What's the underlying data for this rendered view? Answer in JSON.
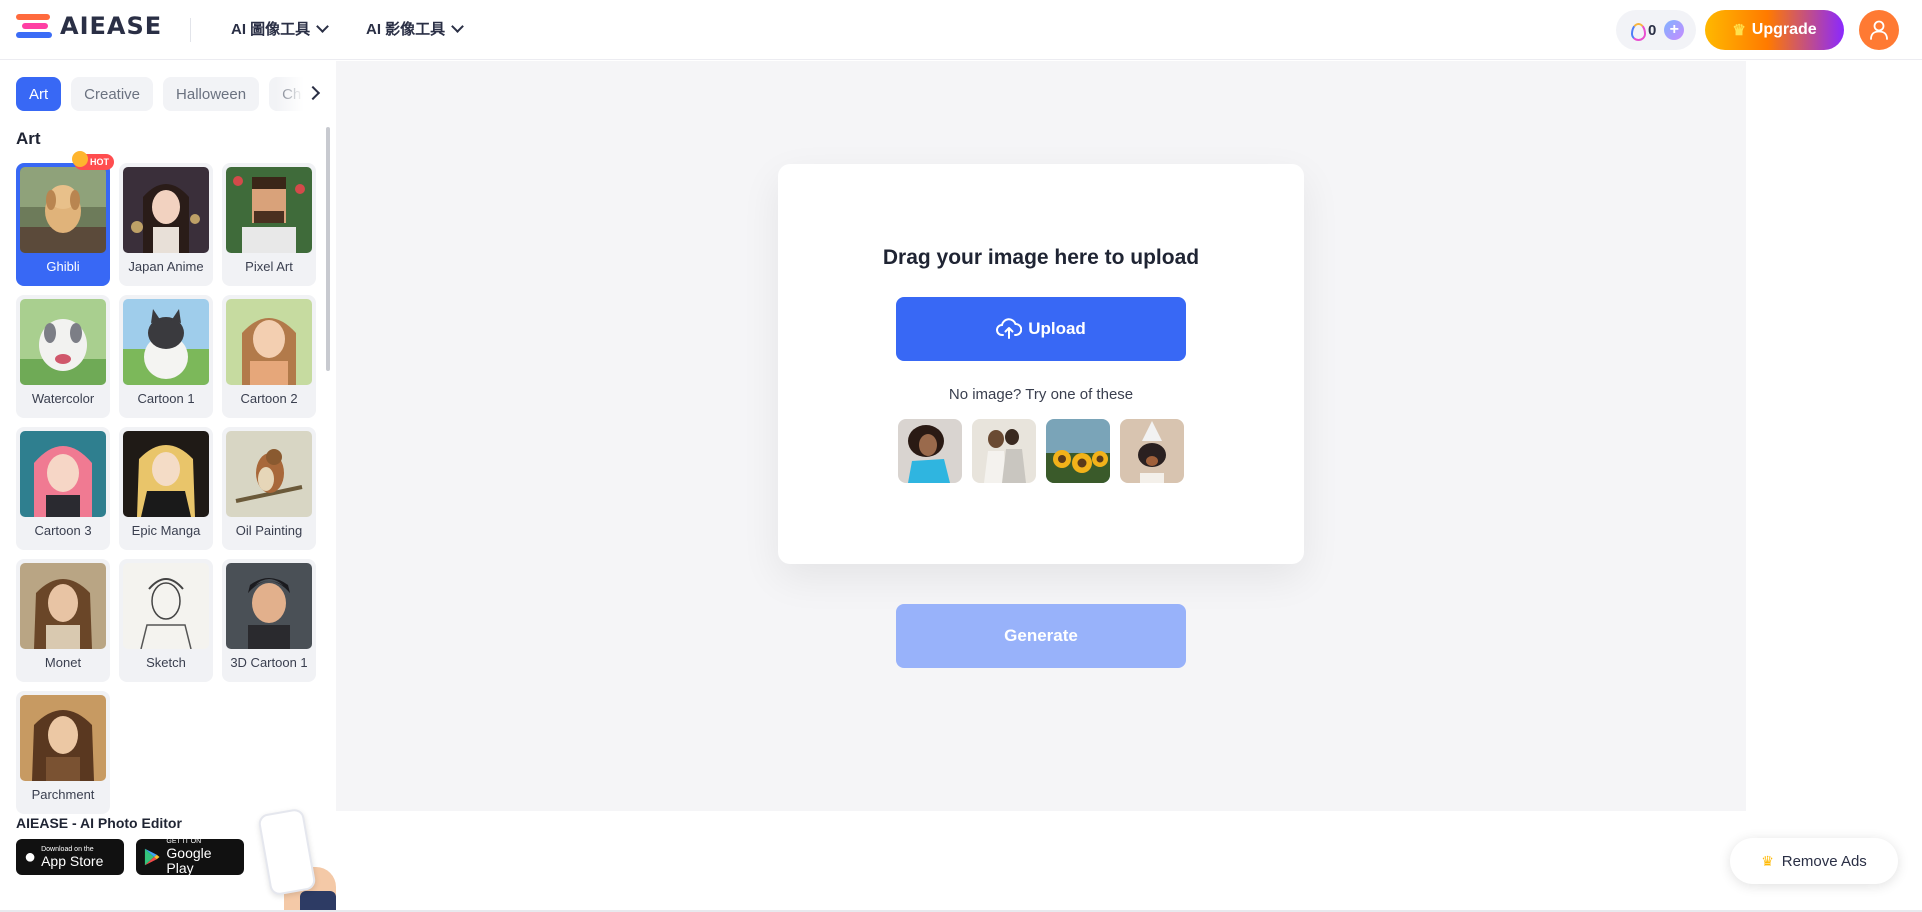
{
  "header": {
    "logo_text": "AIEASE",
    "nav": [
      {
        "label": "AI 圖像工具"
      },
      {
        "label": "AI 影像工具"
      }
    ],
    "credits": "0",
    "upgrade_label": "Upgrade"
  },
  "sidebar": {
    "tabs": [
      {
        "label": "Art",
        "active": true
      },
      {
        "label": "Creative",
        "active": false
      },
      {
        "label": "Halloween",
        "active": false
      },
      {
        "label": "Ch",
        "active": false
      }
    ],
    "section_title": "Art",
    "hot_badge": "HOT",
    "styles": [
      {
        "label": "Ghibli",
        "active": true
      },
      {
        "label": "Japan Anime"
      },
      {
        "label": "Pixel Art"
      },
      {
        "label": "Watercolor"
      },
      {
        "label": "Cartoon 1"
      },
      {
        "label": "Cartoon 2"
      },
      {
        "label": "Cartoon 3"
      },
      {
        "label": "Epic Manga"
      },
      {
        "label": "Oil Painting"
      },
      {
        "label": "Monet"
      },
      {
        "label": "Sketch"
      },
      {
        "label": "3D Cartoon 1"
      },
      {
        "label": "Parchment"
      }
    ],
    "promo": {
      "title": "AIEASE - AI Photo Editor",
      "app_store_small": "Download on the",
      "app_store_big": "App Store",
      "google_play_small": "GET IT ON",
      "google_play_big": "Google Play"
    }
  },
  "main": {
    "drag_title": "Drag your image here to upload",
    "upload_label": "Upload",
    "try_text": "No image? Try one of these",
    "generate_label": "Generate"
  },
  "remove_ads_label": "Remove Ads"
}
